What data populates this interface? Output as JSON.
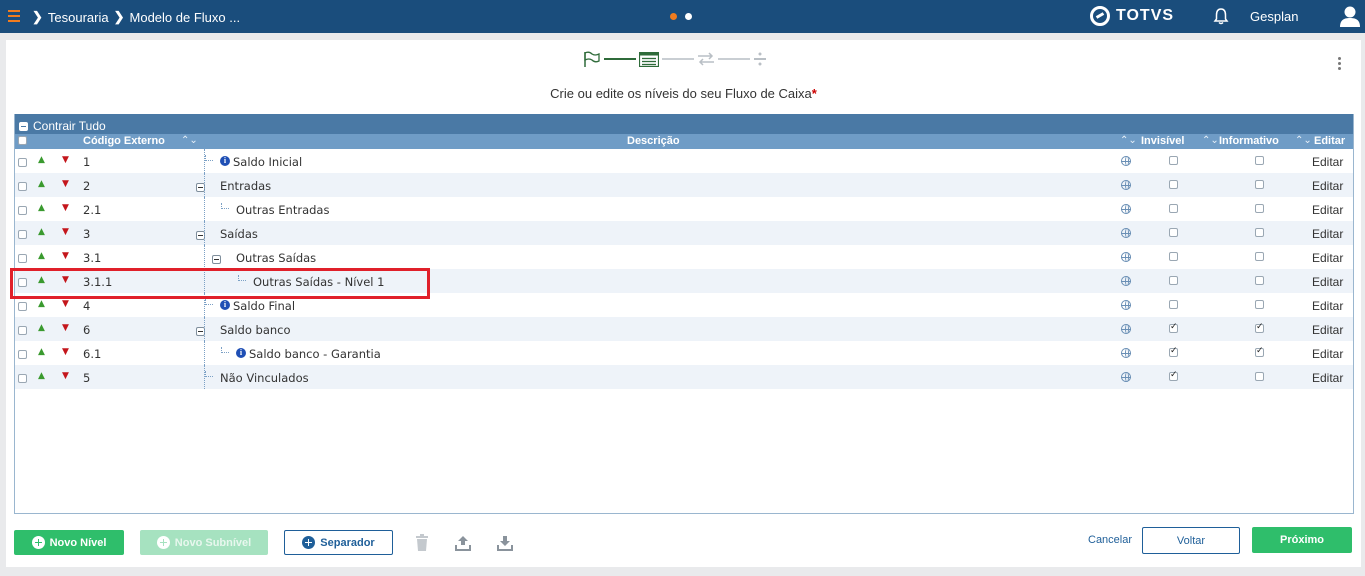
{
  "topbar": {
    "breadcrumb": [
      "Tesouraria",
      "Modelo de Fluxo ..."
    ],
    "brand": "TOTVS",
    "user": "Gesplan",
    "page_dots": [
      "active",
      "inactive"
    ],
    "colors": {
      "bar": "#1a4d7c",
      "accent": "#f07c1f"
    }
  },
  "stepper": {
    "steps": [
      "flag-icon",
      "list-icon",
      "transfer-icon",
      "divide-icon"
    ],
    "active_step": 2
  },
  "heading": {
    "text": "Crie ou edite os níveis do seu Fluxo de Caixa",
    "required_mark": "*"
  },
  "grid": {
    "group_toggle": "Contrair Tudo",
    "columns": {
      "code": "Código Externo",
      "description": "Descrição",
      "invisible": "Invisível",
      "informative": "Informativo",
      "edit": "Editar"
    },
    "rows": [
      {
        "code": "1",
        "description": "Saldo Inicial",
        "level": 0,
        "info": true,
        "expandable": false,
        "invisible": false,
        "informative": false,
        "edit": "Editar"
      },
      {
        "code": "2",
        "description": "Entradas",
        "level": 0,
        "info": false,
        "expandable": true,
        "invisible": false,
        "informative": false,
        "edit": "Editar"
      },
      {
        "code": "2.1",
        "description": "Outras Entradas",
        "level": 1,
        "info": false,
        "expandable": false,
        "invisible": false,
        "informative": false,
        "edit": "Editar"
      },
      {
        "code": "3",
        "description": "Saídas",
        "level": 0,
        "info": false,
        "expandable": true,
        "invisible": false,
        "informative": false,
        "edit": "Editar"
      },
      {
        "code": "3.1",
        "description": "Outras Saídas",
        "level": 1,
        "info": false,
        "expandable": true,
        "invisible": false,
        "informative": false,
        "edit": "Editar"
      },
      {
        "code": "3.1.1",
        "description": "Outras Saídas - Nível 1",
        "level": 2,
        "info": false,
        "expandable": false,
        "invisible": false,
        "informative": false,
        "edit": "Editar"
      },
      {
        "code": "4",
        "description": "Saldo Final",
        "level": 0,
        "info": true,
        "expandable": false,
        "invisible": false,
        "informative": false,
        "edit": "Editar"
      },
      {
        "code": "6",
        "description": "Saldo banco",
        "level": 0,
        "info": false,
        "expandable": true,
        "invisible": true,
        "informative": true,
        "edit": "Editar"
      },
      {
        "code": "6.1",
        "description": "Saldo banco - Garantia",
        "level": 1,
        "info": true,
        "expandable": false,
        "invisible": true,
        "informative": true,
        "edit": "Editar"
      },
      {
        "code": "5",
        "description": "Não Vinculados",
        "level": 0,
        "info": false,
        "expandable": false,
        "invisible": true,
        "informative": false,
        "edit": "Editar"
      }
    ],
    "highlighted_row": "3.1.1"
  },
  "footer": {
    "new_level": "Novo Nível",
    "new_sublevel": "Novo Subnível",
    "separator": "Separador",
    "cancel": "Cancelar",
    "back": "Voltar",
    "next": "Próximo",
    "icons": [
      "trash-icon",
      "upload-icon",
      "download-icon"
    ]
  }
}
